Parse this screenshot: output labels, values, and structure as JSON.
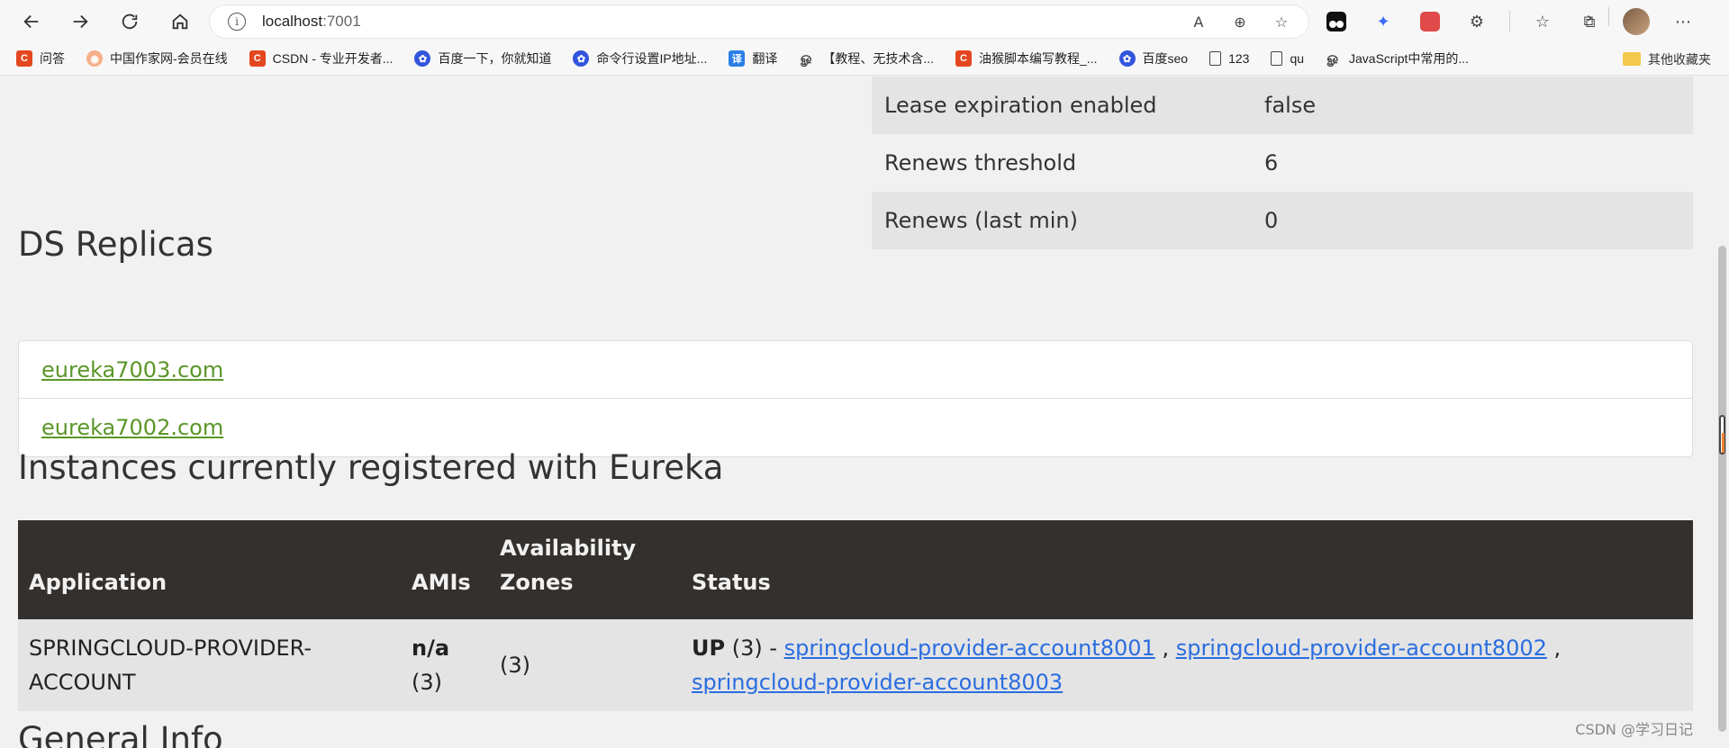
{
  "browser": {
    "url_host": "localhost",
    "url_port": ":7001",
    "info_icon": "i",
    "bookmarks": [
      {
        "label": "问答",
        "icon": "C",
        "kind": "c"
      },
      {
        "label": "中国作家网-会员在线",
        "icon": "◉",
        "kind": "o"
      },
      {
        "label": "CSDN - 专业开发者...",
        "icon": "C",
        "kind": "c"
      },
      {
        "label": "百度一下，你就知道",
        "icon": "✿",
        "kind": "paw"
      },
      {
        "label": "命令行设置IP地址...",
        "icon": "✿",
        "kind": "paw"
      },
      {
        "label": "翻译",
        "icon": "译",
        "kind": "yi"
      },
      {
        "label": "【教程、无技术含...",
        "icon": "ௐ",
        "kind": "om"
      },
      {
        "label": "油猴脚本编写教程_...",
        "icon": "C",
        "kind": "c"
      },
      {
        "label": "百度seo",
        "icon": "✿",
        "kind": "paw"
      },
      {
        "label": "123",
        "icon": "",
        "kind": "doc"
      },
      {
        "label": "qu",
        "icon": "",
        "kind": "doc"
      },
      {
        "label": "JavaScript中常用的...",
        "icon": "ௐ",
        "kind": "om"
      }
    ],
    "other_bookmarks": "其他收藏夹"
  },
  "general_status": {
    "rows": [
      {
        "label": "Lease expiration enabled",
        "value": "false"
      },
      {
        "label": "Renews threshold",
        "value": "6"
      },
      {
        "label": "Renews (last min)",
        "value": "0"
      }
    ]
  },
  "ds_replicas": {
    "title": "DS Replicas",
    "items": [
      "eureka7003.com",
      "eureka7002.com"
    ]
  },
  "instances": {
    "title": "Instances currently registered with Eureka",
    "headers": {
      "application": "Application",
      "amis": "AMIs",
      "availability": "Availability Zones",
      "status": "Status"
    },
    "rows": [
      {
        "application": "SPRINGCLOUD-PROVIDER-ACCOUNT",
        "amis": "n/a",
        "amis_count": "(3)",
        "zones": "(3)",
        "status_word": "UP",
        "status_count": " (3) - ",
        "links": [
          "springcloud-provider-account8001",
          "springcloud-provider-account8002",
          "springcloud-provider-account8003"
        ]
      }
    ]
  },
  "general_info": {
    "title": "General Info"
  },
  "watermark": "CSDN @学习日记",
  "colors": {
    "header_bg": "#34302d",
    "replica_link": "#5b9628",
    "instance_link": "#2b6de0"
  }
}
